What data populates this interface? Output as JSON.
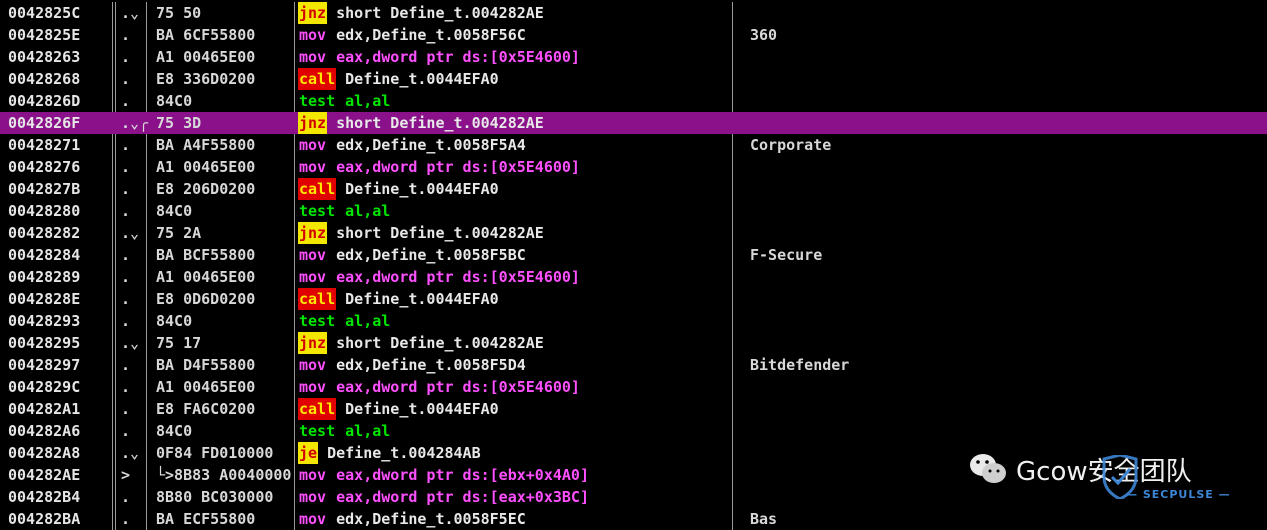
{
  "rows": [
    {
      "addr": "0042825C",
      "arrow": ".⌄",
      "hex": "75 50",
      "mnem": "jnz",
      "mclass": "m-jmp",
      "ops": [
        {
          "t": "short Define_t.004282AE",
          "c": "t-white"
        }
      ],
      "comment": ""
    },
    {
      "addr": "0042825E",
      "arrow": ".",
      "hex": "BA 6CF55800",
      "mnem": "mov",
      "mclass": "m-mov",
      "ops": [
        {
          "t": "edx,Define_t.0058F56C",
          "c": "t-white"
        }
      ],
      "comment": "360"
    },
    {
      "addr": "00428263",
      "arrow": ".",
      "hex": "A1 00465E00",
      "mnem": "mov",
      "mclass": "m-mov",
      "ops": [
        {
          "t": "eax,dword ptr ds:[0x5E4600]",
          "c": "t-pink"
        }
      ],
      "comment": ""
    },
    {
      "addr": "00428268",
      "arrow": ".",
      "hex": "E8 336D0200",
      "mnem": "call",
      "mclass": "m-call",
      "ops": [
        {
          "t": "Define_t.0044EFA0",
          "c": "t-white"
        }
      ],
      "comment": ""
    },
    {
      "addr": "0042826D",
      "arrow": ".",
      "hex": "84C0",
      "mnem": "test",
      "mclass": "m-test",
      "ops": [
        {
          "t": "al,al",
          "c": "t-green"
        }
      ],
      "comment": ""
    },
    {
      "addr": "0042826F",
      "arrow": ".⌄╭",
      "hex": "75 3D",
      "mnem": "jnz",
      "mclass": "m-jmp",
      "ops": [
        {
          "t": "short Define_t.004282AE",
          "c": "t-white"
        }
      ],
      "comment": "",
      "selected": true
    },
    {
      "addr": "00428271",
      "arrow": ".",
      "hex": "BA A4F55800",
      "mnem": "mov",
      "mclass": "m-mov",
      "ops": [
        {
          "t": "edx,Define_t.0058F5A4",
          "c": "t-white"
        }
      ],
      "comment": "Corporate"
    },
    {
      "addr": "00428276",
      "arrow": ".",
      "hex": "A1 00465E00",
      "mnem": "mov",
      "mclass": "m-mov",
      "ops": [
        {
          "t": "eax,dword ptr ds:[0x5E4600]",
          "c": "t-pink"
        }
      ],
      "comment": ""
    },
    {
      "addr": "0042827B",
      "arrow": ".",
      "hex": "E8 206D0200",
      "mnem": "call",
      "mclass": "m-call",
      "ops": [
        {
          "t": "Define_t.0044EFA0",
          "c": "t-white"
        }
      ],
      "comment": ""
    },
    {
      "addr": "00428280",
      "arrow": ".",
      "hex": "84C0",
      "mnem": "test",
      "mclass": "m-test",
      "ops": [
        {
          "t": "al,al",
          "c": "t-green"
        }
      ],
      "comment": ""
    },
    {
      "addr": "00428282",
      "arrow": ".⌄",
      "hex": "75 2A",
      "mnem": "jnz",
      "mclass": "m-jmp",
      "ops": [
        {
          "t": "short Define_t.004282AE",
          "c": "t-white"
        }
      ],
      "comment": ""
    },
    {
      "addr": "00428284",
      "arrow": ".",
      "hex": "BA BCF55800",
      "mnem": "mov",
      "mclass": "m-mov",
      "ops": [
        {
          "t": "edx,Define_t.0058F5BC",
          "c": "t-white"
        }
      ],
      "comment": "F-Secure"
    },
    {
      "addr": "00428289",
      "arrow": ".",
      "hex": "A1 00465E00",
      "mnem": "mov",
      "mclass": "m-mov",
      "ops": [
        {
          "t": "eax,dword ptr ds:[0x5E4600]",
          "c": "t-pink"
        }
      ],
      "comment": ""
    },
    {
      "addr": "0042828E",
      "arrow": ".",
      "hex": "E8 0D6D0200",
      "mnem": "call",
      "mclass": "m-call",
      "ops": [
        {
          "t": "Define_t.0044EFA0",
          "c": "t-white"
        }
      ],
      "comment": ""
    },
    {
      "addr": "00428293",
      "arrow": ".",
      "hex": "84C0",
      "mnem": "test",
      "mclass": "m-test",
      "ops": [
        {
          "t": "al,al",
          "c": "t-green"
        }
      ],
      "comment": ""
    },
    {
      "addr": "00428295",
      "arrow": ".⌄",
      "hex": "75 17",
      "mnem": "jnz",
      "mclass": "m-jmp",
      "ops": [
        {
          "t": "short Define_t.004282AE",
          "c": "t-white"
        }
      ],
      "comment": ""
    },
    {
      "addr": "00428297",
      "arrow": ".",
      "hex": "BA D4F55800",
      "mnem": "mov",
      "mclass": "m-mov",
      "ops": [
        {
          "t": "edx,Define_t.0058F5D4",
          "c": "t-white"
        }
      ],
      "comment": "Bitdefender"
    },
    {
      "addr": "0042829C",
      "arrow": ".",
      "hex": "A1 00465E00",
      "mnem": "mov",
      "mclass": "m-mov",
      "ops": [
        {
          "t": "eax,dword ptr ds:[0x5E4600]",
          "c": "t-pink"
        }
      ],
      "comment": ""
    },
    {
      "addr": "004282A1",
      "arrow": ".",
      "hex": "E8 FA6C0200",
      "mnem": "call",
      "mclass": "m-call",
      "ops": [
        {
          "t": "Define_t.0044EFA0",
          "c": "t-white"
        }
      ],
      "comment": ""
    },
    {
      "addr": "004282A6",
      "arrow": ".",
      "hex": "84C0",
      "mnem": "test",
      "mclass": "m-test",
      "ops": [
        {
          "t": "al,al",
          "c": "t-green"
        }
      ],
      "comment": ""
    },
    {
      "addr": "004282A8",
      "arrow": ".⌄",
      "hex": "0F84 FD010000",
      "mnem": "je",
      "mclass": "m-jmp",
      "ops": [
        {
          "t": "Define_t.004284AB",
          "c": "t-white"
        }
      ],
      "comment": ""
    },
    {
      "addr": "004282AE",
      "arrow": ">",
      "hex": "└>8B83 A0040000",
      "mnem": "mov",
      "mclass": "m-mov",
      "ops": [
        {
          "t": "eax,dword ptr ds:[ebx+0x4A0]",
          "c": "t-pink"
        }
      ],
      "comment": ""
    },
    {
      "addr": "004282B4",
      "arrow": ".",
      "hex": "8B80 BC030000",
      "mnem": "mov",
      "mclass": "m-mov",
      "ops": [
        {
          "t": "eax,dword ptr ds:[eax+0x3BC]",
          "c": "t-pink"
        }
      ],
      "comment": ""
    },
    {
      "addr": "004282BA",
      "arrow": ".",
      "hex": "BA ECF55800",
      "mnem": "mov",
      "mclass": "m-mov",
      "ops": [
        {
          "t": "edx,Define_t.0058F5EC",
          "c": "t-white"
        }
      ],
      "comment": "Bas"
    }
  ],
  "watermark": {
    "text": "Gcow安全团队",
    "secondary": "— SECPULSE —"
  },
  "colors": {
    "selected_row": "#8a118a",
    "jump_bg": "#f3e600",
    "call_bg": "#e00000",
    "mov": "#ff50ff",
    "test": "#00e600"
  }
}
